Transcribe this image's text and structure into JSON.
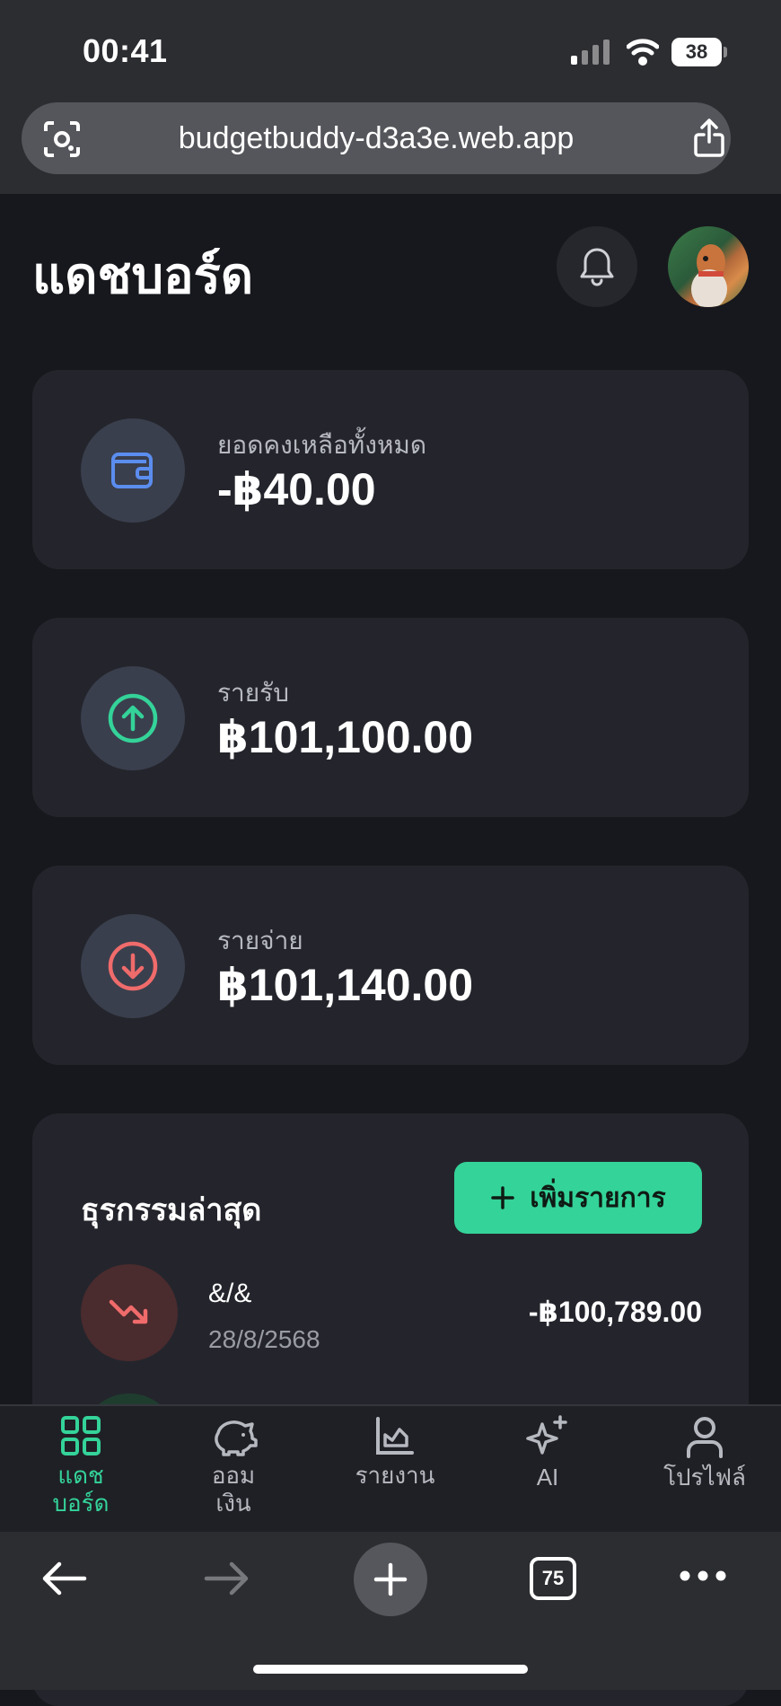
{
  "status": {
    "time": "00:41",
    "battery": "38"
  },
  "browser": {
    "url": "budgetbuddy-d3a3e.web.app",
    "tab_count": "75"
  },
  "header": {
    "title": "แดชบอร์ด"
  },
  "summary": [
    {
      "label": "ยอดคงเหลือทั้งหมด",
      "value": "-฿40.00",
      "icon": "wallet-icon",
      "color": "#5b8def"
    },
    {
      "label": "รายรับ",
      "value": "฿101,100.00",
      "icon": "arrow-up-circle-icon",
      "color": "#34d399"
    },
    {
      "label": "รายจ่าย",
      "value": "฿101,140.00",
      "icon": "arrow-down-circle-icon",
      "color": "#f06b6b"
    }
  ],
  "transactions": {
    "title": "ธุรกรรมล่าสุด",
    "add_label": "เพิ่มรายการ",
    "items": [
      {
        "name": "&/&",
        "date": "28/8/2568",
        "amount": "-฿100,789.00",
        "icon": "trending-down-icon"
      }
    ]
  },
  "nav": [
    {
      "line1": "แดช",
      "line2": "บอร์ด",
      "icon": "dashboard-grid-icon",
      "active": true
    },
    {
      "line1": "ออม",
      "line2": "เงิน",
      "icon": "piggy-bank-icon",
      "active": false
    },
    {
      "line1": "รายงาน",
      "line2": "",
      "icon": "chart-icon",
      "active": false
    },
    {
      "line1": "AI",
      "line2": "",
      "icon": "sparkles-icon",
      "active": false
    },
    {
      "line1": "โปรไฟล์",
      "line2": "",
      "icon": "user-icon",
      "active": false
    }
  ],
  "colors": {
    "accent": "#34d399",
    "income": "#34d399",
    "expense": "#f06b6b",
    "background": "#17181d",
    "card": "#24252c"
  }
}
